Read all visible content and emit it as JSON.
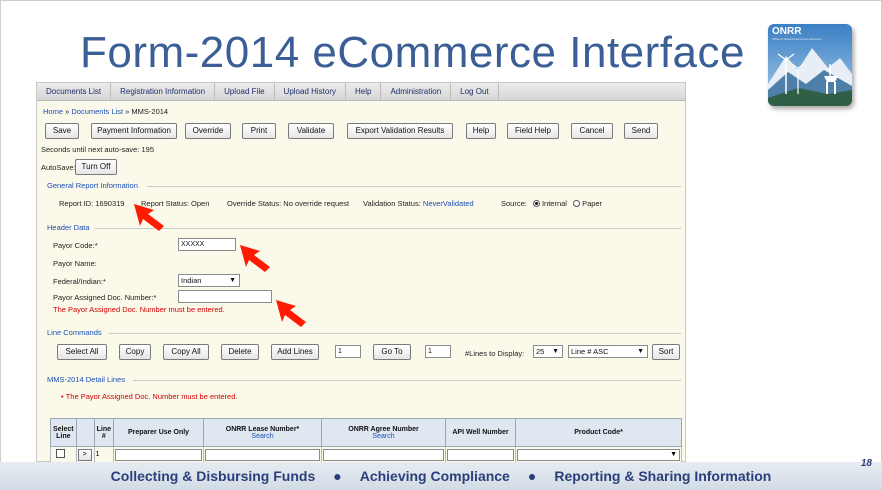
{
  "slide": {
    "title": "Form-2014 eCommerce Interface",
    "logo_text": "ONRR",
    "logo_subtitle": "Office of Natural Resources Revenue",
    "page_number": "18",
    "footer": {
      "item1": "Collecting & Disbursing Funds",
      "item2": "Achieving Compliance",
      "item3": "Reporting & Sharing Information",
      "separator": "●"
    }
  },
  "menu": [
    "Documents List",
    "Registration Information",
    "Upload File",
    "Upload History",
    "Help",
    "Administration",
    "Log Out"
  ],
  "breadcrumb": {
    "home": "Home",
    "sep": "»",
    "documents": "Documents List",
    "current": "MMS-2014"
  },
  "toolbar": {
    "save": "Save",
    "payment": "Payment Information",
    "override": "Override",
    "print": "Print",
    "validate": "Validate",
    "export": "Export Validation Results",
    "help": "Help",
    "field_help": "Field Help",
    "cancel": "Cancel",
    "send": "Send"
  },
  "autosave": {
    "countdown": "Seconds until next auto-save: 195",
    "label": "AutoSave:",
    "button": "Turn Off"
  },
  "general_info": {
    "section_title": "General Report Information",
    "report_id": "Report ID: 1690319",
    "report_status": "Report Status:  Open",
    "override_status": "Override Status:  No override request",
    "validation_label": "Validation Status:",
    "validation_value": "NeverValidated",
    "source_label": "Source:",
    "source_internal": "Internal",
    "source_paper": "Paper",
    "source_selected": "Internal"
  },
  "header_data": {
    "section_title": "Header Data",
    "payor_code_label": "Payor Code:*",
    "payor_code_value": "XXXXX",
    "payor_name_label": "Payor Name:",
    "federal_label": "Federal/Indian:*",
    "federal_value": "Indian",
    "doc_number_label": "Payor Assigned Doc. Number:*",
    "doc_number_value": "",
    "doc_number_error": "The Payor Assigned Doc. Number must be entered."
  },
  "line_commands": {
    "section_title": "Line Commands",
    "select_all": "Select All",
    "copy": "Copy",
    "copy_all": "Copy All",
    "delete": "Delete",
    "add_lines": "Add Lines",
    "add_lines_count": "1",
    "go_to": "Go To",
    "go_to_value": "1",
    "lines_label": "#Lines to Display:",
    "lines_value": "25",
    "sort_value": "Line # ASC",
    "sort": "Sort"
  },
  "detail": {
    "section_title": "MMS-2014 Detail Lines",
    "error": "The Payor Assigned Doc. Number must be entered.",
    "columns": [
      {
        "label": "Select Line"
      },
      {
        "label": ""
      },
      {
        "label": "Line #"
      },
      {
        "label": "Preparer Use Only"
      },
      {
        "label": "ONRR Lease Number*",
        "sub": "Search"
      },
      {
        "label": "ONRR Agree Number",
        "sub": "Search"
      },
      {
        "label": "API Well Number"
      },
      {
        "label": "Product Code*"
      }
    ],
    "row": {
      "expand": ">",
      "line": "1"
    }
  }
}
